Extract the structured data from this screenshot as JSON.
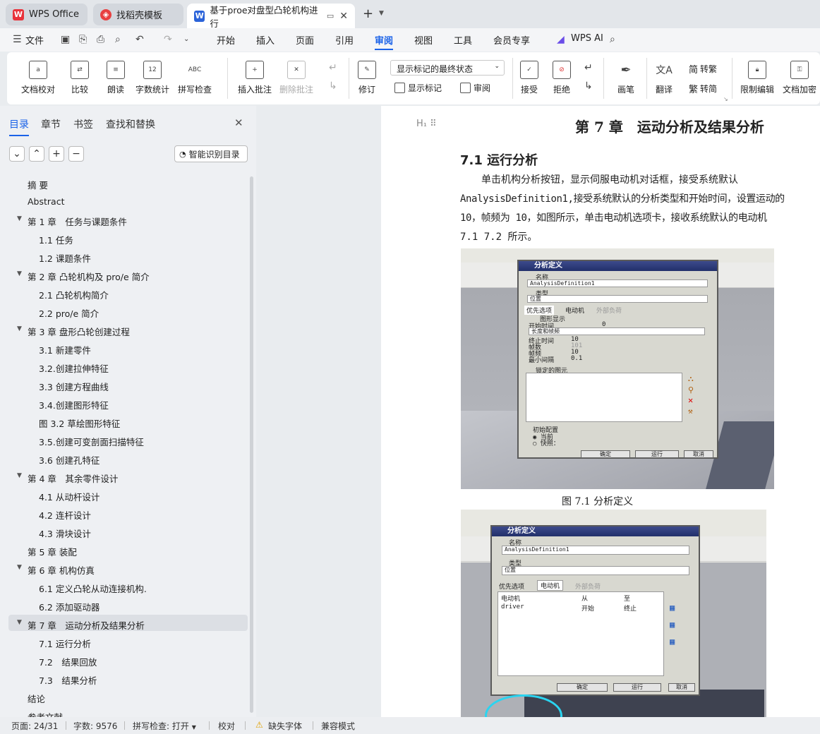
{
  "tabs": [
    {
      "label": "WPS Office",
      "icon": "wps-logo-icon"
    },
    {
      "label": "找稻壳模板",
      "icon": "docer-icon"
    },
    {
      "label": "基于proe对盘型凸轮机构进行",
      "icon": "word-doc-icon"
    }
  ],
  "menu": {
    "file": "文件",
    "items": [
      "开始",
      "插入",
      "页面",
      "引用",
      "审阅",
      "视图",
      "工具",
      "会员专享"
    ],
    "active": "审阅",
    "wps_ai": "WPS AI"
  },
  "ribbon": {
    "doc_check": "文档校对",
    "compare": "比较",
    "read_aloud": "朗读",
    "word_count": "字数统计",
    "spell_check": "拼写检查",
    "insert_comment": "插入批注",
    "delete_comment": "删除批注",
    "revise": "修订",
    "markup_state": "显示标记的最终状态",
    "show_markup": "显示标记",
    "review": "审阅",
    "accept": "接受",
    "reject": "拒绝",
    "brush": "画笔",
    "translate": "翻译",
    "to_traditional": "转繁",
    "to_simplified": "转简",
    "restrict_edit": "限制编辑",
    "encrypt": "文档加密"
  },
  "nav": {
    "tabs": [
      "目录",
      "章节",
      "书签",
      "查找和替换"
    ],
    "smart_toc": "智能识别目录",
    "toc": [
      {
        "t": "摘 要",
        "l": 1
      },
      {
        "t": "Abstract",
        "l": 1
      },
      {
        "t": "第 1 章　任务与课题条件",
        "l": 1,
        "e": true
      },
      {
        "t": "1.1 任务",
        "l": 2
      },
      {
        "t": "1.2 课题条件",
        "l": 2
      },
      {
        "t": "第 2 章 凸轮机构及 pro/e 简介",
        "l": 1,
        "e": true
      },
      {
        "t": "2.1 凸轮机构简介",
        "l": 2
      },
      {
        "t": "2.2 pro/e 简介",
        "l": 2
      },
      {
        "t": "第 3 章 盘形凸轮创建过程",
        "l": 1,
        "e": true
      },
      {
        "t": "3.1 新建零件",
        "l": 2
      },
      {
        "t": "3.2.创建拉伸特征",
        "l": 2
      },
      {
        "t": "3.3 创建方程曲线",
        "l": 2
      },
      {
        "t": "3.4.创建图形特征",
        "l": 2
      },
      {
        "t": "图 3.2 草绘图形特征",
        "l": 2
      },
      {
        "t": "3.5.创建可变剖面扫描特征",
        "l": 2
      },
      {
        "t": "3.6 创建孔特征",
        "l": 2
      },
      {
        "t": "第 4 章　其余零件设计",
        "l": 1,
        "e": true
      },
      {
        "t": "4.1 从动杆设计",
        "l": 2
      },
      {
        "t": "4.2 连杆设计",
        "l": 2
      },
      {
        "t": "4.3 滑块设计",
        "l": 2
      },
      {
        "t": "第 5 章 装配",
        "l": 1
      },
      {
        "t": "第 6 章 机构仿真",
        "l": 1,
        "e": true
      },
      {
        "t": "6.1 定义凸轮从动连接机构.",
        "l": 2
      },
      {
        "t": "6.2 添加驱动器",
        "l": 2
      },
      {
        "t": "第 7 章　运动分析及结果分析",
        "l": 1,
        "e": true,
        "sel": true
      },
      {
        "t": "7.1 运行分析",
        "l": 2
      },
      {
        "t": "7.2　结果回放",
        "l": 2
      },
      {
        "t": "7.3　结果分析",
        "l": 2
      },
      {
        "t": "结论",
        "l": 1
      },
      {
        "t": "参考文献",
        "l": 1
      }
    ]
  },
  "doc": {
    "chapter_title": "第 7 章　运动分析及结果分析",
    "section_title": "7.1  运行分析",
    "para": [
      "单击机构分析按钮，显示伺服电动机对话框，接受系统默认",
      "AnalysisDefinition1,接受系统默认的分析类型和开始时间，设置运动的",
      "10，帧频为 10，如图所示，单击电动机选项卡，接收系统默认的电动机",
      "7.1 7.2 所示。"
    ],
    "fig1_caption": "图 7.1 分析定义",
    "dlg1": {
      "title": "分析定义",
      "name_label": "名称",
      "name_value": "AnalysisDefinition1",
      "type_label": "类型",
      "type_value": "位置",
      "tabs": [
        "优先选项",
        "电动机",
        "外部负荷"
      ],
      "graph": "图形显示",
      "start": "开始时间",
      "start_val": "0",
      "mode": "长度和帧频",
      "end": "终止时间",
      "end_val": "10",
      "frames": "帧数",
      "frames_val": "101",
      "rate": "帧频",
      "rate_val": "10",
      "interval": "最小间隔",
      "interval_val": "0.1",
      "locked": "锁定的图元",
      "init": "初始配置",
      "current": "当前",
      "snapshot": "快照：",
      "ok": "确定",
      "run": "运行",
      "cancel": "取消"
    },
    "dlg2": {
      "title": "分析定义",
      "name_label": "名称",
      "name_value": "AnalysisDefinition1",
      "type_label": "类型",
      "type_value": "位置",
      "tabs": [
        "优先选项",
        "电动机",
        "外部负荷"
      ],
      "col_motor": "电动机",
      "col_from": "从",
      "col_to": "至",
      "motor": "driver",
      "from": "开始",
      "to": "终止",
      "ok": "确定",
      "run": "运行",
      "cancel": "取消"
    }
  },
  "status": {
    "page": "页面: 24/31",
    "words": "字数: 9576",
    "spell": "拼写检查: 打开",
    "proof": "校对",
    "missing_font": "缺失字体",
    "compat": "兼容模式"
  }
}
